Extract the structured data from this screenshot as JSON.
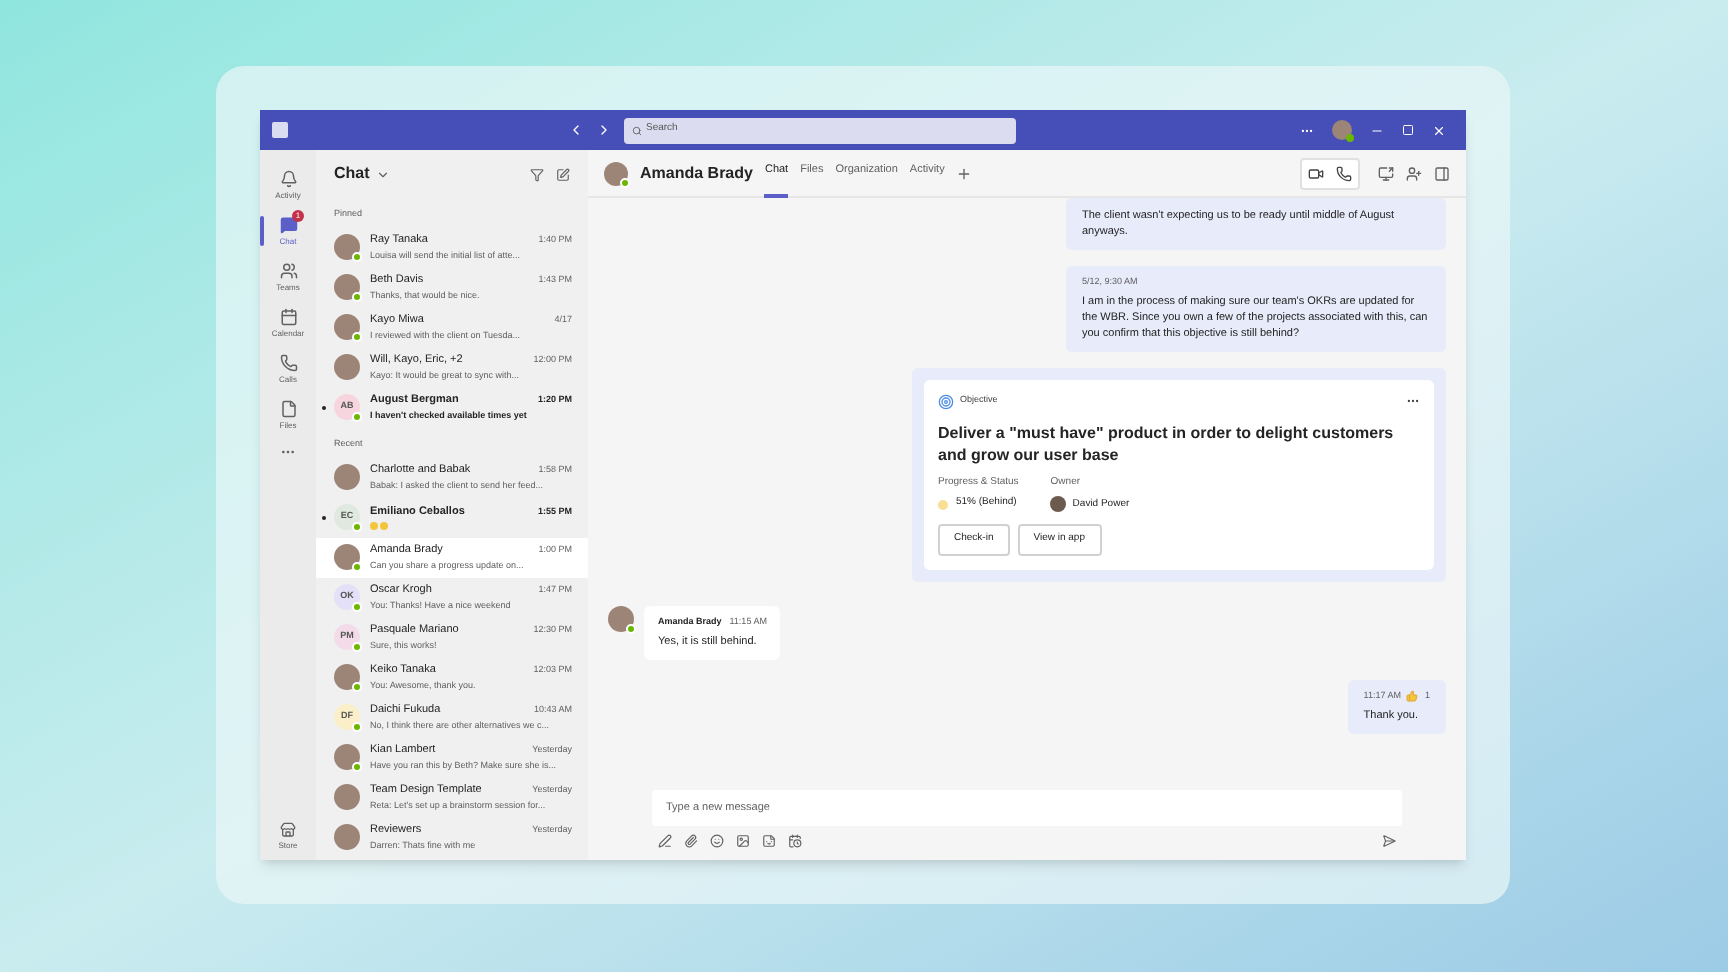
{
  "title_bar": {
    "search_placeholder": "Search"
  },
  "rail": [
    {
      "label": "Activity",
      "kind": "bell",
      "selected": false
    },
    {
      "label": "Chat",
      "kind": "chat",
      "selected": true,
      "badge": "1"
    },
    {
      "label": "Teams",
      "kind": "teams",
      "selected": false
    },
    {
      "label": "Calendar",
      "kind": "calendar",
      "selected": false
    },
    {
      "label": "Calls",
      "kind": "calls",
      "selected": false
    },
    {
      "label": "Files",
      "kind": "files",
      "selected": false
    }
  ],
  "rail_bottom": {
    "label": "Store"
  },
  "chat_list": {
    "title": "Chat",
    "sections": [
      {
        "label": "Pinned",
        "chats": [
          {
            "name": "Ray Tanaka",
            "preview": "Louisa will send the initial list of atte...",
            "time": "1:40 PM",
            "avatar": {
              "kind": "photo"
            },
            "online": true,
            "unread": false,
            "selected": false
          },
          {
            "name": "Beth Davis",
            "preview": "Thanks, that would be nice.",
            "time": "1:43 PM",
            "avatar": {
              "kind": "photo"
            },
            "online": true,
            "unread": false,
            "selected": false
          },
          {
            "name": "Kayo Miwa",
            "preview": "I reviewed with the client on Tuesda...",
            "time": "4/17",
            "avatar": {
              "kind": "photo"
            },
            "online": true,
            "unread": false,
            "selected": false
          },
          {
            "name": "Will, Kayo, Eric, +2",
            "preview": "Kayo: It would be great to sync with...",
            "time": "12:00 PM",
            "avatar": {
              "kind": "photo"
            },
            "online": false,
            "unread": false,
            "selected": false
          },
          {
            "name": "August Bergman",
            "preview": "I haven't checked available times yet",
            "time": "1:20 PM",
            "avatar": {
              "kind": "initials",
              "initials": "AB",
              "color": "#f6d5de"
            },
            "online": true,
            "unread": true,
            "selected": false
          }
        ]
      },
      {
        "label": "Recent",
        "chats": [
          {
            "name": "Charlotte and Babak",
            "preview": "Babak: I asked the client to send her feed...",
            "time": "1:58 PM",
            "avatar": {
              "kind": "photo"
            },
            "online": false,
            "unread": false,
            "selected": false
          },
          {
            "name": "Emiliano Ceballos",
            "emoji_preview": true,
            "time": "1:55 PM",
            "avatar": {
              "kind": "initials",
              "initials": "EC",
              "color": "#dfe9df"
            },
            "online": true,
            "unread": true,
            "selected": false
          },
          {
            "name": "Amanda Brady",
            "preview": "Can you share a progress update on...",
            "time": "1:00 PM",
            "avatar": {
              "kind": "photo"
            },
            "online": true,
            "unread": false,
            "selected": true
          },
          {
            "name": "Oscar Krogh",
            "preview": "You: Thanks! Have a nice weekend",
            "time": "1:47 PM",
            "avatar": {
              "kind": "initials",
              "initials": "OK",
              "color": "#e3e0f7"
            },
            "online": true,
            "unread": false,
            "selected": false
          },
          {
            "name": "Pasquale Mariano",
            "preview": "Sure, this works!",
            "time": "12:30 PM",
            "avatar": {
              "kind": "initials",
              "initials": "PM",
              "color": "#f4dbe9"
            },
            "online": true,
            "unread": false,
            "selected": false
          },
          {
            "name": "Keiko Tanaka",
            "preview": "You: Awesome, thank you.",
            "time": "12:03 PM",
            "avatar": {
              "kind": "photo"
            },
            "online": true,
            "unread": false,
            "selected": false
          },
          {
            "name": "Daichi Fukuda",
            "preview": "No, I think there are other alternatives we c...",
            "time": "10:43 AM",
            "avatar": {
              "kind": "initials",
              "initials": "DF",
              "color": "#fbefc9"
            },
            "online": true,
            "unread": false,
            "selected": false
          },
          {
            "name": "Kian Lambert",
            "preview": "Have you ran this by Beth? Make sure she is...",
            "time": "Yesterday",
            "avatar": {
              "kind": "photo"
            },
            "online": true,
            "unread": false,
            "selected": false
          },
          {
            "name": "Team Design Template",
            "preview": "Reta: Let's set up a brainstorm session for...",
            "time": "Yesterday",
            "avatar": {
              "kind": "photo"
            },
            "online": false,
            "unread": false,
            "selected": false
          },
          {
            "name": "Reviewers",
            "preview": "Darren: Thats fine with me",
            "time": "Yesterday",
            "avatar": {
              "kind": "photo"
            },
            "online": false,
            "unread": false,
            "selected": false
          }
        ]
      }
    ]
  },
  "conversation": {
    "name": "Amanda Brady",
    "tabs": [
      {
        "label": "Chat",
        "selected": true
      },
      {
        "label": "Files",
        "selected": false
      },
      {
        "label": "Organization",
        "selected": false
      },
      {
        "label": "Activity",
        "selected": false
      }
    ],
    "messages": [
      {
        "kind": "sent",
        "text": "The client wasn't expecting us to be ready until middle of August anyways."
      },
      {
        "kind": "sent",
        "meta": "5/12, 9:30 AM",
        "text": "I am in the process of making sure our team's OKRs are updated for the WBR. Since you own a few of the projects associated with this, can you confirm that this objective is still behind?"
      },
      {
        "kind": "card",
        "label": "Objective",
        "title": "Deliver a \"must have\" product in order to delight customers and grow our user base",
        "progress_label": "Progress & Status",
        "progress": "51% (Behind)",
        "owner_label": "Owner",
        "owner": "David Power",
        "buttons": [
          "Check-in",
          "View in app"
        ]
      },
      {
        "kind": "received",
        "author": "Amanda Brady",
        "meta": "11:15 AM",
        "text": "Yes, it is still behind."
      },
      {
        "kind": "sent",
        "meta": "11:17 AM",
        "reaction_count": "1",
        "text": "Thank you."
      }
    ],
    "compose_placeholder": "Type a new message"
  }
}
